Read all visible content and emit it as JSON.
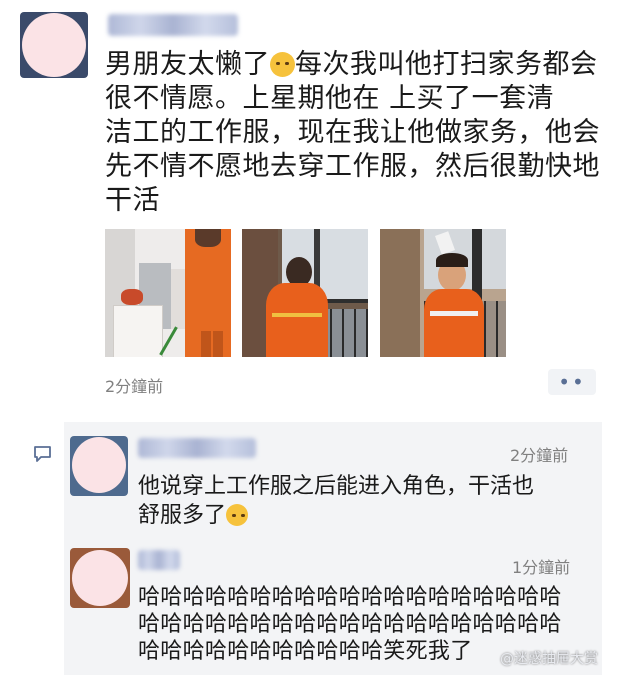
{
  "post": {
    "author_name": "",
    "text_line1": "男朋友太懒了",
    "text_rest": "每次我叫他打扫家务都会\n很不情愿。上星期他在        上买了一套清\n洁工的工作服，现在我让他做家务，他会\n先不情不愿地去穿工作服，然后很勤快地\n干活",
    "emoji_icon": "crying-laughing-emoji",
    "time": "2分鐘前",
    "more_label": "••"
  },
  "comments": [
    {
      "author_name": "",
      "time": "2分鐘前",
      "text_a": "他说穿上工作服之后能进入角色，干活也\n舒服多了",
      "emoji_icon": "crying-laughing-emoji"
    },
    {
      "author_name": "",
      "time": "1分鐘前",
      "text": "哈哈哈哈哈哈哈哈哈哈哈哈哈哈哈哈哈哈哈哈哈哈哈哈哈哈哈哈哈哈哈哈哈哈哈哈哈哈哈哈哈哈哈哈哈哈哈哈哈笑死我了"
    }
  ],
  "watermark": "@迷惑抽屉大赏",
  "colors": {
    "link_blue": "#5a6f95",
    "comment_bg": "#f3f4f6",
    "uniform_orange": "#e8601c"
  }
}
